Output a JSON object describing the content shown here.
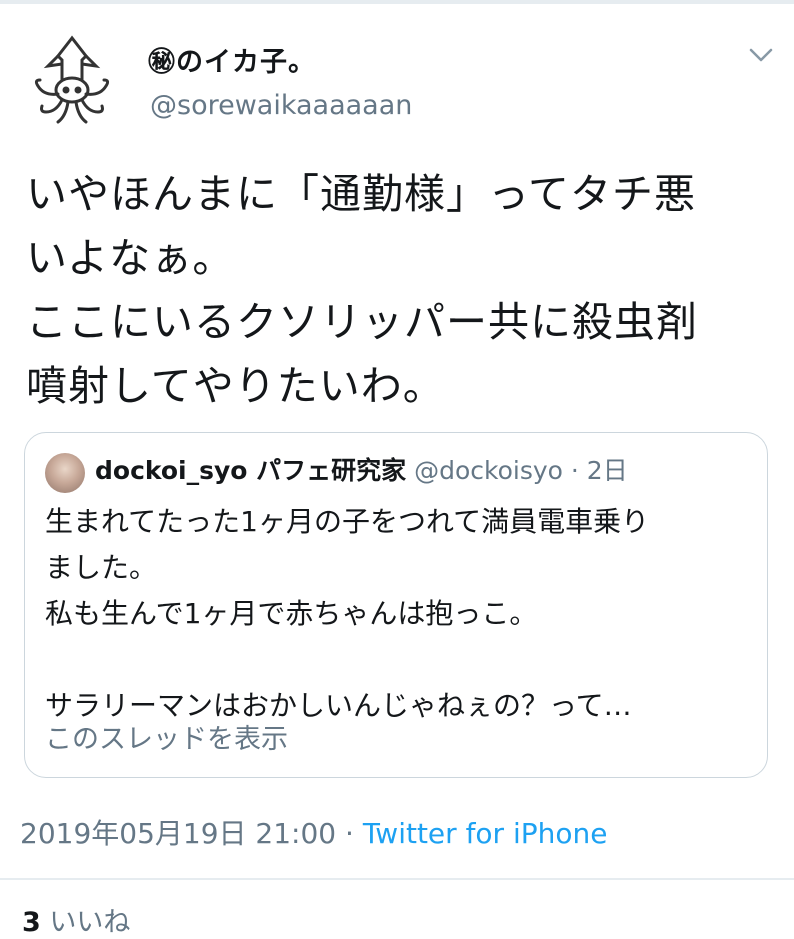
{
  "tweet": {
    "display_name": "㊙のイカ子。",
    "handle": "@sorewaikaaaaaan",
    "avatar_icon": "squid-icon",
    "menu_icon": "chevron-down-icon",
    "text_lines": [
      "いやほんまに「通勤様」ってタチ悪",
      "いよなぁ。",
      "ここにいるクソリッパー共に殺虫剤",
      "噴射してやりたいわ。"
    ],
    "timestamp": "2019年05月19日 21:00",
    "separator": "·",
    "source": "Twitter for iPhone",
    "likes_count": "3",
    "likes_label": "いいね"
  },
  "quoted": {
    "display_name": "dockoi_syo パフェ研究家",
    "handle_and_age": "@dockoisyo · 2日",
    "body_lines": [
      "生まれてたった1ヶ月の子をつれて満員電車乗り",
      "ました。",
      "私も生んで1ヶ月で赤ちゃんは抱っこ。",
      "",
      "サラリーマンはおかしいんじゃねぇの？って…"
    ],
    "show_thread": "このスレッドを表示"
  },
  "colors": {
    "text": "#14171a",
    "secondary": "#657786",
    "link": "#1da1f2",
    "border": "#ccd6dd"
  }
}
